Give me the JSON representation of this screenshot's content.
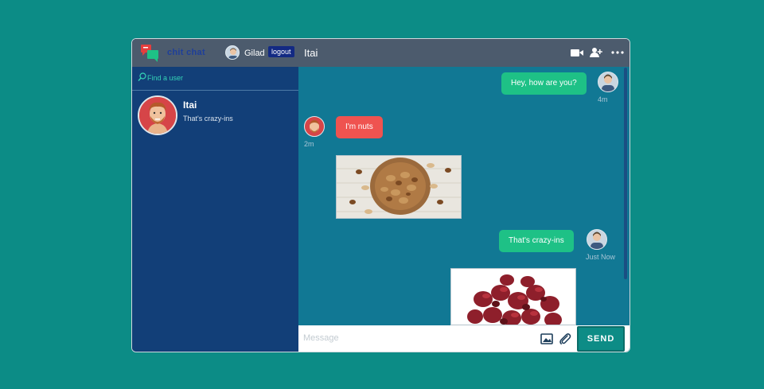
{
  "app": {
    "brand": "chit chat"
  },
  "user": {
    "name": "Gilad",
    "logout_label": "logout"
  },
  "search": {
    "placeholder": "Find a user"
  },
  "contacts": [
    {
      "name": "Itai",
      "last_message": "That's crazy-ins"
    }
  ],
  "chat": {
    "title": "Itai",
    "messages": [
      {
        "direction": "out",
        "text": "Hey, how are you?",
        "time": "4m"
      },
      {
        "direction": "in",
        "text": "I'm nuts",
        "time": "2m"
      },
      {
        "direction": "in",
        "type": "image",
        "image": "mixed-nuts-photo"
      },
      {
        "direction": "out",
        "text": "That's crazy-ins",
        "time": "Just Now"
      },
      {
        "direction": "out",
        "type": "image",
        "image": "dried-cranberries-photo"
      }
    ]
  },
  "composer": {
    "placeholder": "Message",
    "send_label": "SEND"
  },
  "icons": [
    "logo-icon",
    "search-icon",
    "video-camera-icon",
    "add-user-icon",
    "more-icon",
    "image-icon",
    "paperclip-icon"
  ],
  "colors": {
    "background": "#0c8c86",
    "sidebar": "#123f78",
    "chat": "#117894",
    "header": "#4c5b6d",
    "outgoing": "#1ec186",
    "incoming": "#ef5350",
    "accent": "#34d3b6"
  }
}
